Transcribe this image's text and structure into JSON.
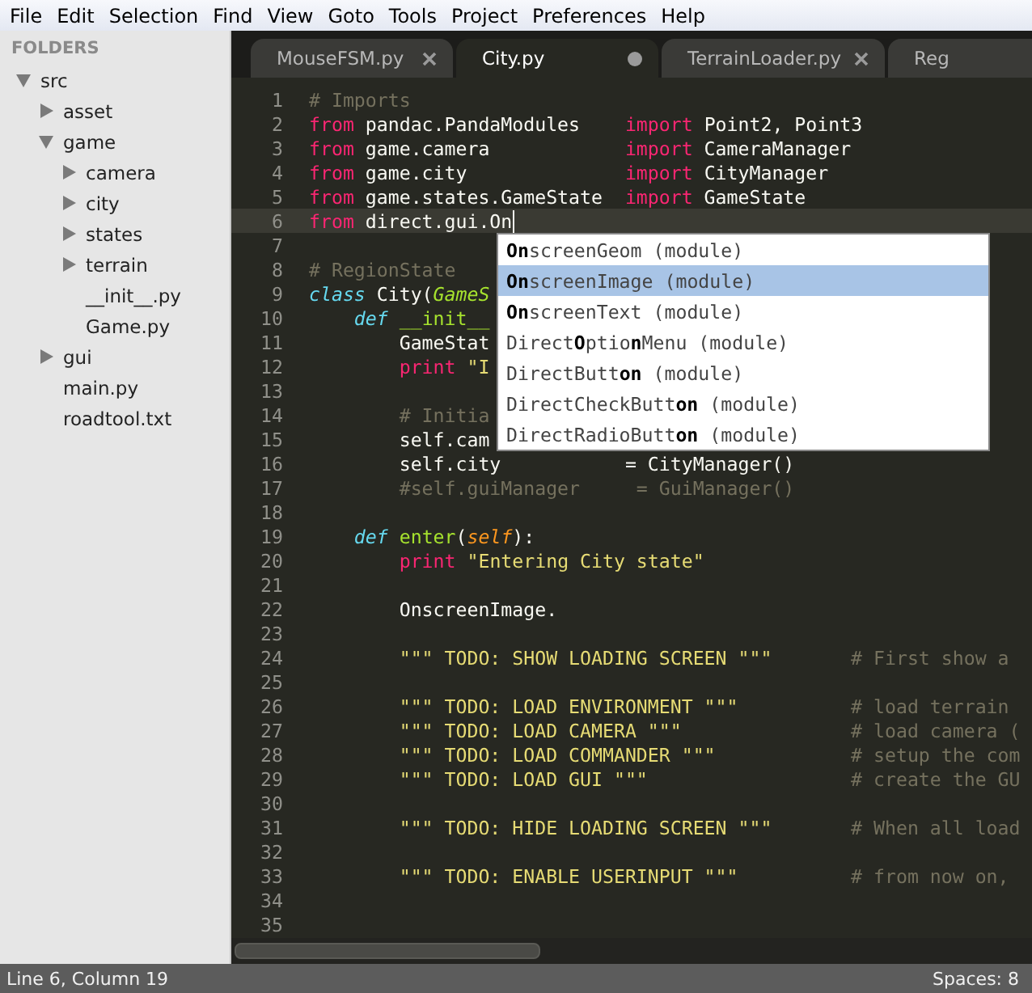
{
  "menu": [
    "File",
    "Edit",
    "Selection",
    "Find",
    "View",
    "Goto",
    "Tools",
    "Project",
    "Preferences",
    "Help"
  ],
  "sidebar": {
    "title": "FOLDERS",
    "tree": [
      {
        "name": "src",
        "kind": "folder",
        "expanded": true,
        "children": [
          {
            "name": "asset",
            "kind": "folder",
            "expanded": false
          },
          {
            "name": "game",
            "kind": "folder",
            "expanded": true,
            "children": [
              {
                "name": "camera",
                "kind": "folder",
                "expanded": false
              },
              {
                "name": "city",
                "kind": "folder",
                "expanded": false
              },
              {
                "name": "states",
                "kind": "folder",
                "expanded": false
              },
              {
                "name": "terrain",
                "kind": "folder",
                "expanded": false
              },
              {
                "name": "__init__.py",
                "kind": "file"
              },
              {
                "name": "Game.py",
                "kind": "file"
              }
            ]
          },
          {
            "name": "gui",
            "kind": "folder",
            "expanded": false
          },
          {
            "name": "main.py",
            "kind": "file"
          },
          {
            "name": "roadtool.txt",
            "kind": "file"
          }
        ]
      }
    ]
  },
  "tabs": [
    {
      "label": "MouseFSM.py",
      "selected": false,
      "modified": false
    },
    {
      "label": "City.py",
      "selected": true,
      "modified": true
    },
    {
      "label": "TerrainLoader.py",
      "selected": false,
      "modified": false
    },
    {
      "label": "Reg",
      "selected": false
    }
  ],
  "editor": {
    "lines": [
      {
        "number": "1",
        "current": false,
        "tokens": [
          {
            "kind": "comment",
            "text": "# Imports"
          }
        ]
      },
      {
        "number": "2",
        "current": false,
        "tokens": [
          {
            "kind": "keyword",
            "text": "from"
          },
          {
            "kind": "plain",
            "text": " pandac.PandaModules"
          },
          {
            "kind": "keyword",
            "text": "    import"
          },
          {
            "kind": "plain",
            "text": " Point2, Point3"
          }
        ]
      },
      {
        "number": "3",
        "current": false,
        "tokens": [
          {
            "kind": "keyword",
            "text": "from"
          },
          {
            "kind": "plain",
            "text": " game.camera"
          },
          {
            "kind": "keyword",
            "text": "            import"
          },
          {
            "kind": "plain",
            "text": " CameraManager"
          }
        ]
      },
      {
        "number": "4",
        "current": false,
        "tokens": [
          {
            "kind": "keyword",
            "text": "from"
          },
          {
            "kind": "plain",
            "text": " game.city"
          },
          {
            "kind": "keyword",
            "text": "              import"
          },
          {
            "kind": "plain",
            "text": " CityManager"
          }
        ]
      },
      {
        "number": "5",
        "current": false,
        "tokens": [
          {
            "kind": "keyword",
            "text": "from"
          },
          {
            "kind": "plain",
            "text": " game.states.GameState"
          },
          {
            "kind": "keyword",
            "text": "  import"
          },
          {
            "kind": "plain",
            "text": " GameState"
          }
        ]
      },
      {
        "number": "6",
        "current": true,
        "tokens": [
          {
            "kind": "keyword",
            "text": "from"
          },
          {
            "kind": "plain",
            "text": " direct.gui.On"
          }
        ]
      },
      {
        "number": "7",
        "current": false
      },
      {
        "number": "8",
        "current": false,
        "tokens": [
          {
            "kind": "comment",
            "text": "# RegionState"
          }
        ]
      },
      {
        "number": "9",
        "current": false,
        "tokens": [
          {
            "kind": "storage",
            "text": "class"
          },
          {
            "kind": "plain",
            "text": " City("
          },
          {
            "kind": "inherited",
            "text": "GameS"
          }
        ]
      },
      {
        "number": "10",
        "current": false,
        "tokens": [
          {
            "kind": "storage",
            "text": "    def"
          },
          {
            "kind": "function",
            "text": " __init__"
          }
        ]
      },
      {
        "number": "11",
        "current": false,
        "tokens": [
          {
            "kind": "plain",
            "text": "        GameStat"
          }
        ]
      },
      {
        "number": "12",
        "current": false,
        "tokens": [
          {
            "kind": "keyword",
            "text": "        print"
          },
          {
            "kind": "string",
            "text": " \"I"
          }
        ]
      },
      {
        "number": "13",
        "current": false
      },
      {
        "number": "14",
        "current": false,
        "tokens": [
          {
            "kind": "comment",
            "text": "        # Initia"
          }
        ]
      },
      {
        "number": "15",
        "current": false,
        "tokens": [
          {
            "kind": "plain",
            "text": "        self.cam"
          }
        ]
      },
      {
        "number": "16",
        "current": false,
        "tokens": [
          {
            "kind": "plain",
            "text": "        self.city           = CityManager()"
          }
        ]
      },
      {
        "number": "17",
        "current": false,
        "tokens": [
          {
            "kind": "comment",
            "text": "        #self.guiManager     = GuiManager()"
          }
        ]
      },
      {
        "number": "18",
        "current": false
      },
      {
        "number": "19",
        "current": false,
        "tokens": [
          {
            "kind": "storage",
            "text": "    def"
          },
          {
            "kind": "function",
            "text": " enter"
          },
          {
            "kind": "plain",
            "text": "("
          },
          {
            "kind": "parameter",
            "text": "self"
          },
          {
            "kind": "plain",
            "text": "):"
          }
        ]
      },
      {
        "number": "20",
        "current": false,
        "tokens": [
          {
            "kind": "keyword",
            "text": "        print"
          },
          {
            "kind": "string",
            "text": " \"Entering City state\""
          }
        ]
      },
      {
        "number": "21",
        "current": false
      },
      {
        "number": "22",
        "current": false,
        "tokens": [
          {
            "kind": "plain",
            "text": "        OnscreenImage."
          }
        ]
      },
      {
        "number": "23",
        "current": false
      },
      {
        "number": "24",
        "current": false,
        "tokens": [
          {
            "kind": "string",
            "text": "        \"\"\" TODO: SHOW LOADING SCREEN \"\"\""
          },
          {
            "kind": "comment",
            "text": "       # First show a"
          }
        ]
      },
      {
        "number": "25",
        "current": false
      },
      {
        "number": "26",
        "current": false,
        "tokens": [
          {
            "kind": "string",
            "text": "        \"\"\" TODO: LOAD ENVIRONMENT \"\"\""
          },
          {
            "kind": "comment",
            "text": "          # load terrain"
          }
        ]
      },
      {
        "number": "27",
        "current": false,
        "tokens": [
          {
            "kind": "string",
            "text": "        \"\"\" TODO: LOAD CAMERA \"\"\""
          },
          {
            "kind": "comment",
            "text": "               # load camera ("
          }
        ]
      },
      {
        "number": "28",
        "current": false,
        "tokens": [
          {
            "kind": "string",
            "text": "        \"\"\" TODO: LOAD COMMANDER \"\"\""
          },
          {
            "kind": "comment",
            "text": "            # setup the com"
          }
        ]
      },
      {
        "number": "29",
        "current": false,
        "tokens": [
          {
            "kind": "string",
            "text": "        \"\"\" TODO: LOAD GUI \"\"\""
          },
          {
            "kind": "comment",
            "text": "                  # create the GU"
          }
        ]
      },
      {
        "number": "30",
        "current": false
      },
      {
        "number": "31",
        "current": false,
        "tokens": [
          {
            "kind": "string",
            "text": "        \"\"\" TODO: HIDE LOADING SCREEN \"\"\""
          },
          {
            "kind": "comment",
            "text": "       # When all load"
          }
        ]
      },
      {
        "number": "32",
        "current": false
      },
      {
        "number": "33",
        "current": false,
        "tokens": [
          {
            "kind": "string",
            "text": "        \"\"\" TODO: ENABLE USERINPUT \"\"\""
          },
          {
            "kind": "comment",
            "text": "          # from now on,"
          }
        ]
      },
      {
        "number": "34",
        "current": false
      },
      {
        "number": "35",
        "current": false
      }
    ]
  },
  "autocomplete": [
    {
      "name": "**On**screenGeom",
      "type": "(module)",
      "selected": false
    },
    {
      "name": "**On**screenImage",
      "type": "(module)",
      "selected": true
    },
    {
      "name": "**On**screenText",
      "type": "(module)",
      "selected": false
    },
    {
      "name": "Direct**O**ptio**n**Menu",
      "type": "(module)",
      "selected": false
    },
    {
      "name": "DirectButt**on**",
      "type": "(module)",
      "selected": false
    },
    {
      "name": "DirectCheckButt**on**",
      "type": "(module)",
      "selected": false
    },
    {
      "name": "DirectRadioButt**on**",
      "type": "(module)",
      "selected": false
    }
  ],
  "status_bar": {
    "position": "Line 6, Column 19",
    "indentation": "Spaces: 8"
  }
}
